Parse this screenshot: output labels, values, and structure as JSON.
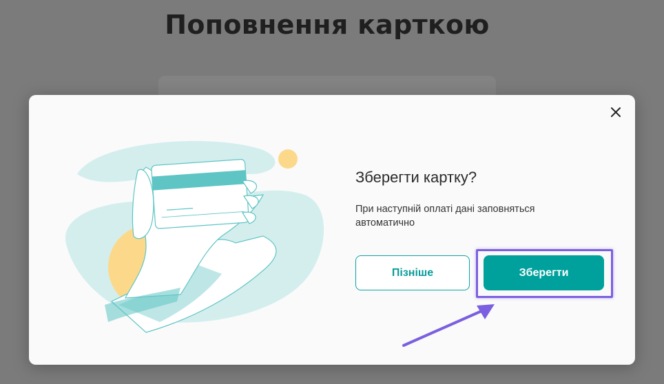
{
  "page": {
    "title": "Поповнення карткою"
  },
  "modal": {
    "title": "Зберегти картку?",
    "description": "При наступній оплаті дані заповняться автоматично",
    "later_label": "Пізніше",
    "save_label": "Зберегти",
    "close_icon": "close-icon"
  },
  "colors": {
    "accent": "#00a19c",
    "highlight": "#7b5fe0",
    "illustration_teal": "#5ec4c4",
    "illustration_light": "#d4eeee",
    "illustration_yellow": "#fcd98a"
  }
}
